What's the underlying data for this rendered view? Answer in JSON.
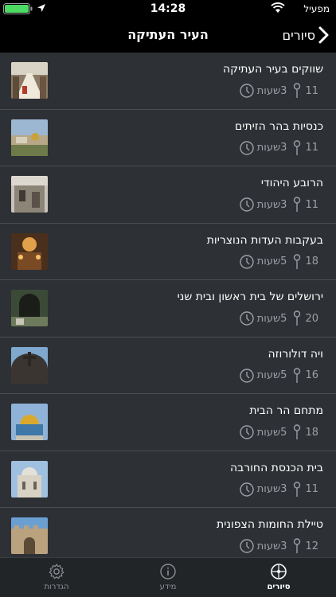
{
  "status": {
    "carrier": "מפעיל",
    "time": "14:28"
  },
  "nav": {
    "title": "העיר העתיקה",
    "back_label": "סיורים"
  },
  "tours": [
    {
      "title": "שווקים בעיר העתיקה",
      "stops": "11",
      "duration": "3שעות",
      "thumb": "market"
    },
    {
      "title": "כנסיות בהר הזיתים",
      "stops": "11",
      "duration": "3שעות",
      "thumb": "olives"
    },
    {
      "title": "הרובע היהודי",
      "stops": "11",
      "duration": "3שעות",
      "thumb": "quarter"
    },
    {
      "title": "בעקבות העדות הנוצריות",
      "stops": "18",
      "duration": "5שעות",
      "thumb": "church"
    },
    {
      "title": "ירושלים של בית ראשון ובית שני",
      "stops": "20",
      "duration": "5שעות",
      "thumb": "tunnel"
    },
    {
      "title": "ויה דולורוזה",
      "stops": "16",
      "duration": "5שעות",
      "thumb": "cross"
    },
    {
      "title": "מתחם הר הבית",
      "stops": "18",
      "duration": "5שעות",
      "thumb": "dome"
    },
    {
      "title": "בית הכנסת החורבה",
      "stops": "11",
      "duration": "3שעות",
      "thumb": "hurva"
    },
    {
      "title": "טיילת החומות הצפונית",
      "stops": "12",
      "duration": "3שעות",
      "thumb": "walls"
    }
  ],
  "tabs": [
    {
      "label": "סיורים",
      "icon": "tours-icon",
      "active": true
    },
    {
      "label": "מידע",
      "icon": "info-icon",
      "active": false
    },
    {
      "label": "הגדרות",
      "icon": "settings-icon",
      "active": false
    }
  ],
  "colors": {
    "background": "#2d3034",
    "bar": "#000000",
    "tabbar": "#222528",
    "meta": "#9ca0a6",
    "battery": "#4cd964"
  }
}
